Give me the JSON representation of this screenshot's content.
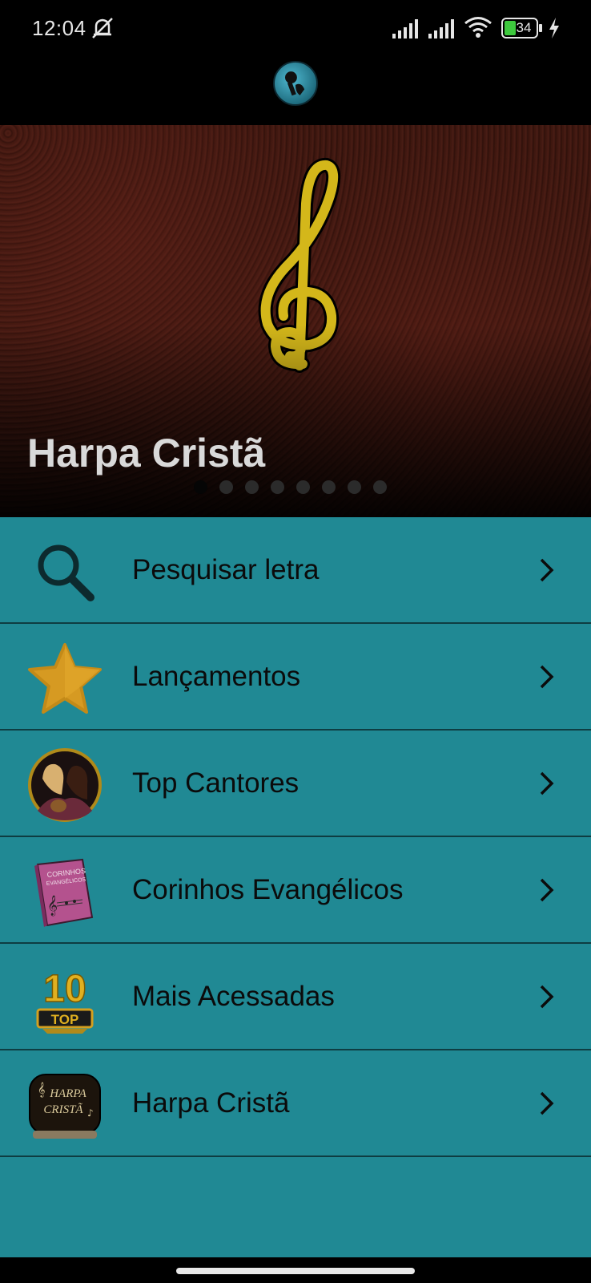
{
  "status_bar": {
    "time": "12:04",
    "battery_level": "34",
    "icons": [
      "mute-icon",
      "signal-icon",
      "signal-icon",
      "wifi-icon",
      "battery-icon",
      "bolt-icon"
    ]
  },
  "header": {
    "logo_icon": "microphone-logo-icon"
  },
  "banner": {
    "title": "Harpa Cristã",
    "page_count": 8,
    "active_page": 1,
    "icon": "treble-clef-icon"
  },
  "menu": {
    "items": [
      {
        "label": "Pesquisar letra",
        "icon": "search-icon"
      },
      {
        "label": "Lançamentos",
        "icon": "star-icon"
      },
      {
        "label": "Top Cantores",
        "icon": "singers-avatar-icon"
      },
      {
        "label": "Corinhos Evangélicos",
        "icon": "songbook-icon"
      },
      {
        "label": "Mais Acessadas",
        "icon": "top-10-icon"
      },
      {
        "label": "Harpa Cristã",
        "icon": "harpa-book-icon"
      }
    ]
  },
  "icon_text": {
    "songbook": [
      "CORINHOS",
      "EVANGÉLICOS"
    ],
    "top10": [
      "10",
      "TOP"
    ],
    "harpa_book": [
      "HARPA",
      "CRISTÃ"
    ]
  },
  "colors": {
    "menu_background": "#208994",
    "divider": "#0e3d42",
    "banner_title": "#d9d9d9",
    "clef": "#d4b71a"
  }
}
